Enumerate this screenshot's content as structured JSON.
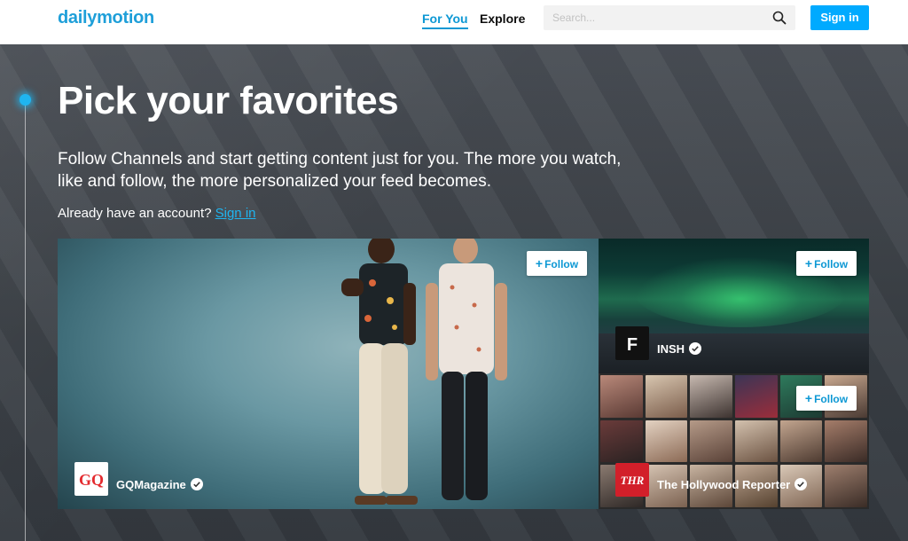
{
  "header": {
    "logo": "dailymotion",
    "tabs": [
      {
        "label": "For You",
        "active": true
      },
      {
        "label": "Explore",
        "active": false
      }
    ],
    "search": {
      "placeholder": "Search...",
      "value": ""
    },
    "signin_label": "Sign in"
  },
  "hero": {
    "title": "Pick your favorites",
    "description": "Follow Channels and start getting content just for you. The more you watch, like and follow, the more personalized your feed becomes.",
    "account_prompt": "Already have an account?",
    "account_link": "Sign in"
  },
  "channels": [
    {
      "name": "GQMagazine",
      "logo_text": "GQ",
      "verified": true,
      "follow_label": "Follow"
    },
    {
      "name": "INSH",
      "logo_text": "F",
      "verified": true,
      "follow_label": "Follow"
    },
    {
      "name": "The Hollywood Reporter",
      "logo_text": "THR",
      "verified": true,
      "follow_label": "Follow"
    }
  ],
  "colors": {
    "accent": "#00aaff",
    "brand": "#1e9fd9",
    "gq_red": "#e42b2f",
    "thr_red": "#d21f2a"
  },
  "icons": {
    "search": "search-icon",
    "verified": "verified-check-icon",
    "plus": "plus-icon"
  }
}
